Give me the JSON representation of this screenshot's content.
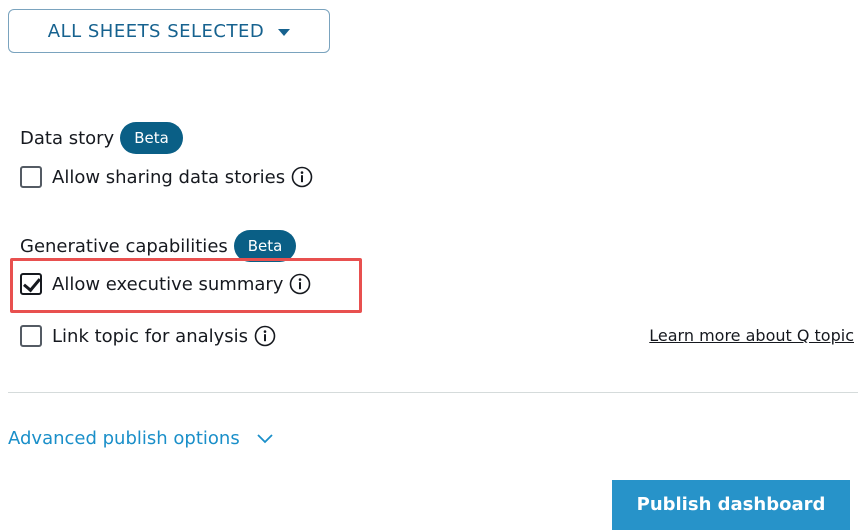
{
  "sheets_dropdown": {
    "label": "ALL SHEETS SELECTED",
    "icon": "caret-down-icon"
  },
  "data_story": {
    "heading": "Data story",
    "badge": "Beta",
    "options": [
      {
        "label": "Allow sharing data stories",
        "checked": false,
        "icon": "info-icon"
      }
    ]
  },
  "generative": {
    "heading": "Generative capabilities",
    "badge": "Beta",
    "options": [
      {
        "label": "Allow executive summary",
        "checked": true,
        "icon": "info-icon",
        "highlighted": true
      },
      {
        "label": "Link topic for analysis",
        "checked": false,
        "icon": "info-icon"
      }
    ],
    "learn_more": "Learn more about Q topic"
  },
  "advanced": {
    "label": "Advanced publish options",
    "icon": "chevron-down-icon"
  },
  "publish_button": {
    "label": "Publish dashboard"
  },
  "colors": {
    "badge": "#0a5f86",
    "link": "#1a8fc9",
    "primary_button": "#2793c9",
    "highlight": "#e8504f"
  }
}
